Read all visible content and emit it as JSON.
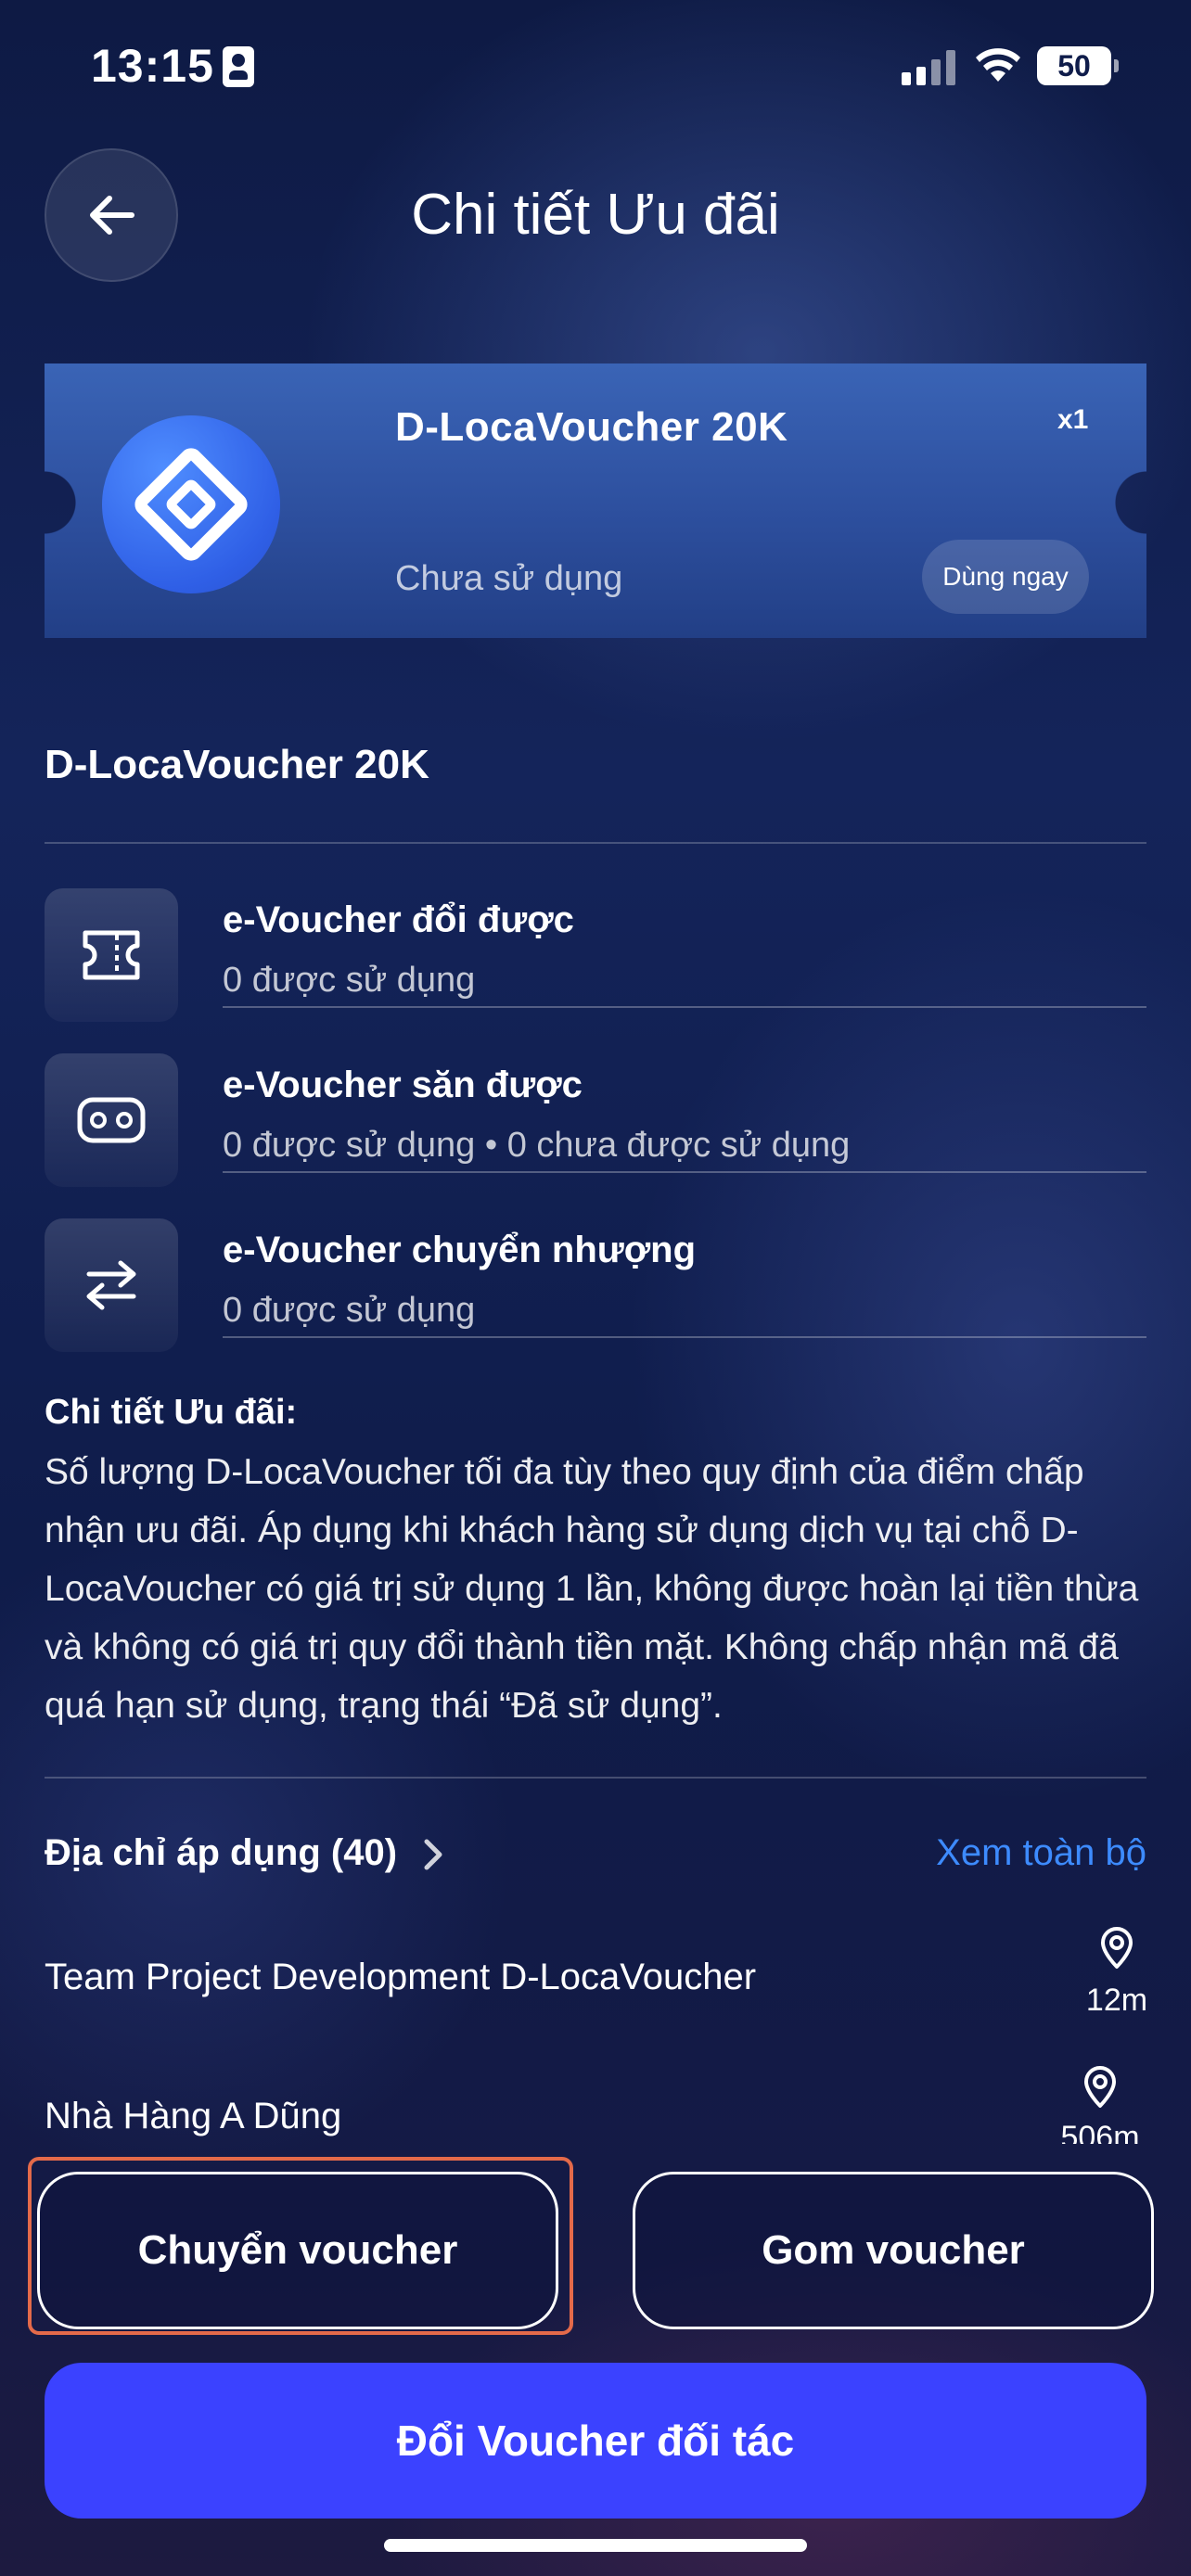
{
  "status_bar": {
    "time": "13:15",
    "battery": "50"
  },
  "header": {
    "title": "Chi tiết Ưu đãi"
  },
  "voucher_card": {
    "name": "D-LocaVoucher 20K",
    "quantity": "x1",
    "status": "Chưa sử dụng",
    "action_label": "Dùng ngay"
  },
  "voucher_name": "D-LocaVoucher 20K",
  "stats": [
    {
      "title": "e-Voucher đổi được",
      "subtitle": "0 được sử dụng",
      "icon": "ticket-icon"
    },
    {
      "title": "e-Voucher săn được",
      "subtitle": "0 được sử dụng • 0 chưa được sử dụng",
      "icon": "vr-goggles-icon"
    },
    {
      "title": "e-Voucher chuyển nhượng",
      "subtitle": "0 được sử dụng",
      "icon": "transfer-arrows-icon"
    }
  ],
  "details": {
    "heading": "Chi tiết Ưu đãi:",
    "body": "Số lượng D-LocaVoucher tối đa tùy theo quy định của điểm chấp nhận ưu đãi. Áp dụng khi khách hàng sử dụng dịch vụ tại chỗ D-LocaVoucher có giá trị sử dụng 1 lần, không được hoàn lại tiền thừa và không có giá trị quy đổi thành tiền mặt. Không chấp nhận mã đã quá hạn sử dụng, trạng thái “Đã sử dụng”."
  },
  "addresses": {
    "heading": "Địa chỉ áp dụng (40)",
    "see_all": "Xem toàn bộ",
    "items": [
      {
        "name": "Team Project Development D-LocaVoucher",
        "distance": "12m"
      },
      {
        "name": "Nhà Hàng A Dũng",
        "distance": "506m"
      }
    ]
  },
  "actions": {
    "transfer": "Chuyển voucher",
    "collect": "Gom voucher",
    "exchange": "Đổi Voucher đối tác"
  },
  "colors": {
    "primary": "#3b42ff",
    "link": "#3d8bff",
    "focus": "#e46a4a"
  }
}
